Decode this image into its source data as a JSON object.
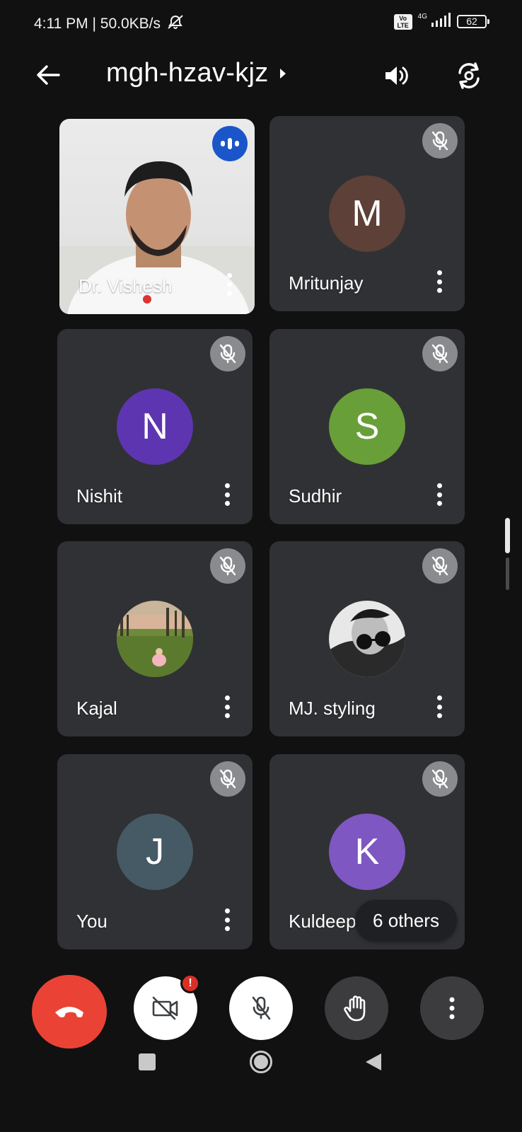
{
  "status_bar": {
    "time_and_speed": "4:11 PM | 50.0KB/s",
    "volte": "Vo LTE",
    "network": "4G",
    "battery": "62"
  },
  "header": {
    "meeting_code": "mgh-hzav-kjz"
  },
  "tiles": [
    {
      "name": "Dr. Vishesh",
      "type": "video",
      "speaking": true
    },
    {
      "name": "Mritunjay",
      "initial": "M",
      "color": "#5d4037",
      "muted": true
    },
    {
      "name": "Nishit",
      "initial": "N",
      "color": "#5e35b1",
      "muted": true
    },
    {
      "name": "Sudhir",
      "initial": "S",
      "color": "#689f38",
      "muted": true
    },
    {
      "name": "Kajal",
      "type": "photo",
      "muted": true
    },
    {
      "name": "MJ. styling",
      "type": "photo",
      "muted": true
    },
    {
      "name": "You",
      "initial": "J",
      "color": "#455a64",
      "muted": true
    },
    {
      "name": "Kuldeep",
      "initial": "K",
      "color": "#7e57c2",
      "muted": true
    }
  ],
  "others_pill": "6 others",
  "controls": {
    "camera_alert": "!"
  }
}
